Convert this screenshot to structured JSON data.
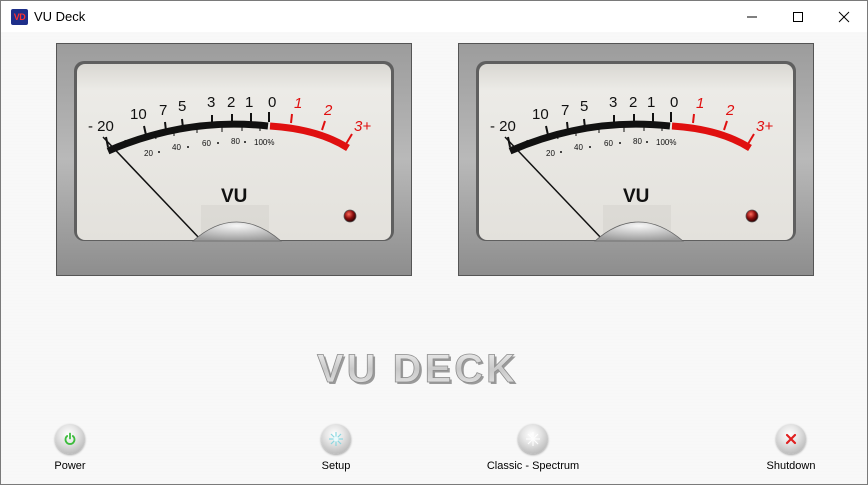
{
  "window": {
    "title": "VU Deck",
    "icon_label": "VD",
    "controls": [
      "minimize-icon",
      "maximize-icon",
      "close-icon"
    ]
  },
  "meters": [
    {
      "label": "VU",
      "db_scale": [
        "- 20",
        "10",
        "7",
        "5",
        "3",
        "2",
        "1",
        "0",
        "1",
        "2",
        "3+"
      ],
      "percent_scale": [
        "20",
        "40",
        "60",
        "80",
        "100%"
      ],
      "needle_level": "-20"
    },
    {
      "label": "VU",
      "db_scale": [
        "- 20",
        "10",
        "7",
        "5",
        "3",
        "2",
        "1",
        "0",
        "1",
        "2",
        "3+"
      ],
      "percent_scale": [
        "20",
        "40",
        "60",
        "80",
        "100%"
      ],
      "needle_level": "-20"
    }
  ],
  "logo_text": "VU DECK",
  "controls": {
    "power": {
      "label": "Power",
      "icon": "power-icon"
    },
    "setup": {
      "label": "Setup",
      "icon": "setup-icon"
    },
    "mode": {
      "label": "Classic - Spectrum",
      "icon": "mode-icon"
    },
    "shutdown": {
      "label": "Shutdown",
      "icon": "shutdown-icon"
    }
  },
  "colors": {
    "red_zone": "#e01010",
    "scale_black": "#111111",
    "dial_face": "#e9e7e2",
    "power_green": "#3cbc3c",
    "shutdown_red": "#e02020"
  }
}
